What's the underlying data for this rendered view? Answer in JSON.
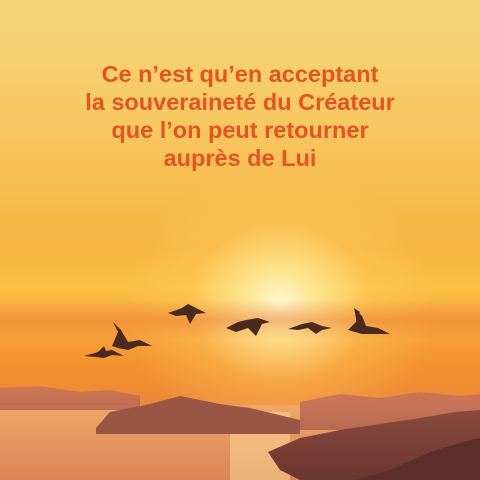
{
  "quote": {
    "lines": [
      "Ce n’est qu’en acceptant",
      "la souveraineté du Créateur",
      "que l’on peut retourner",
      "auprès de Lui"
    ],
    "color": "#e8521f"
  },
  "scene": {
    "sky_colors": [
      "#f6d37a",
      "#f8b43e",
      "#ee8a36"
    ],
    "mountain_color": "#7a3d34",
    "sea_color": "#e89a60",
    "bird_count": 7,
    "subject": "birds-flying-over-sea-at-sunset"
  }
}
